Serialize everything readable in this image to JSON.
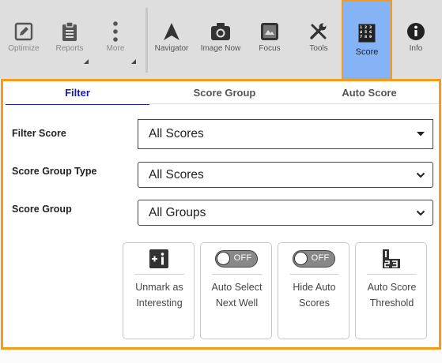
{
  "toolbar": {
    "optimize": "Optimize",
    "reports": "Reports",
    "more": "More",
    "navigator": "Navigator",
    "image_now": "Image Now",
    "focus": "Focus",
    "tools": "Tools",
    "score": "Score",
    "info": "Info"
  },
  "tabs": {
    "filter": "Filter",
    "score_group": "Score Group",
    "auto_score": "Auto Score"
  },
  "form": {
    "filter_score_label": "Filter Score",
    "filter_score_value": "All Scores",
    "score_group_type_label": "Score Group Type",
    "score_group_type_value": "All Scores",
    "score_group_label": "Score Group",
    "score_group_value": "All Groups"
  },
  "cards": {
    "unmark_line1": "Unmark as",
    "unmark_line2": "Interesting",
    "auto_select_line1": "Auto Select",
    "auto_select_line2": "Next Well",
    "hide_auto_line1": "Hide Auto",
    "hide_auto_line2": "Scores",
    "threshold_line1": "Auto Score",
    "threshold_line2": "Threshold",
    "toggle_off": "OFF"
  },
  "colors": {
    "accent": "#f49c1a",
    "active_tab": "#1a1ab8",
    "active_button_bg": "#86b3f5"
  }
}
